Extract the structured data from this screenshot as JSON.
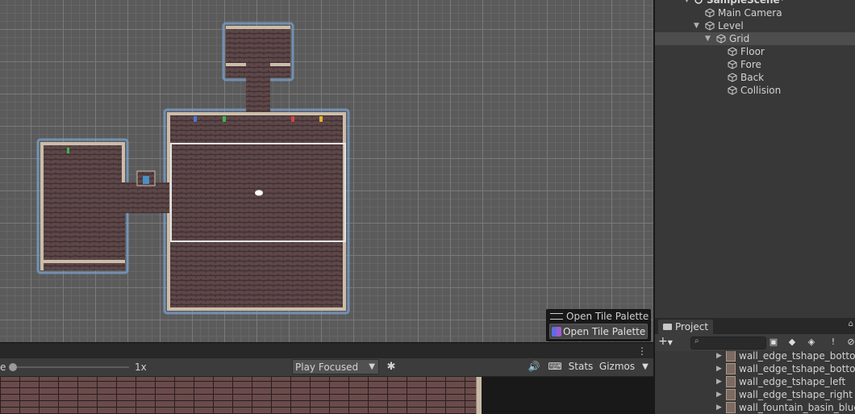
{
  "scene_view": {
    "tile_palette_overlay": {
      "title": "Open Tile Palette",
      "button_label": "Open Tile Palette"
    }
  },
  "game_toolbar": {
    "scale_label": "e",
    "scale_value": "1x",
    "play_mode": "Play Focused",
    "stats_label": "Stats",
    "gizmos_label": "Gizmos"
  },
  "hierarchy": {
    "items": [
      {
        "label": "SampleScene*",
        "indent": 0
      },
      {
        "label": "Main Camera",
        "indent": 1
      },
      {
        "label": "Level",
        "indent": 1
      },
      {
        "label": "Grid",
        "indent": 2
      },
      {
        "label": "Floor",
        "indent": 3
      },
      {
        "label": "Fore",
        "indent": 3
      },
      {
        "label": "Back",
        "indent": 3
      },
      {
        "label": "Collision",
        "indent": 3
      }
    ]
  },
  "project": {
    "tab_label": "Project",
    "add_label": "+",
    "items": [
      "wall_edge_tshape_bottom",
      "wall_edge_tshape_bottom",
      "wall_edge_tshape_left",
      "wall_edge_tshape_right",
      "wall_fountain_basin_blue_"
    ]
  },
  "colors": {
    "scene_bg": "#5b5b5b",
    "floor": "#5a4446",
    "outline": "#7aa5d6",
    "panel": "#383838",
    "selected": "#4d4d4d"
  }
}
